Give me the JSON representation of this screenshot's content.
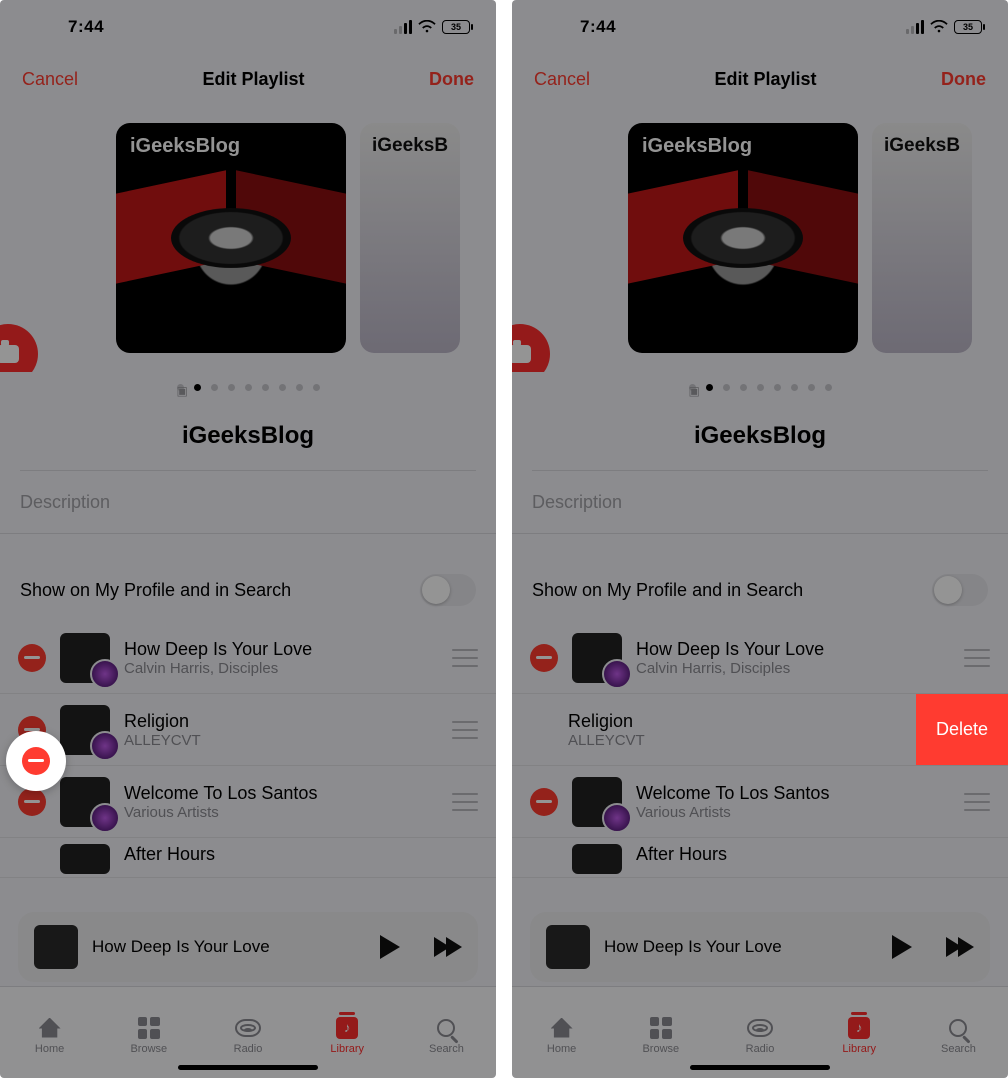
{
  "status": {
    "time": "7:44",
    "battery": "35"
  },
  "nav": {
    "cancel": "Cancel",
    "title": "Edit Playlist",
    "done": "Done"
  },
  "cover": {
    "main_title": "iGeeksBlog",
    "right_title": "iGeeksB"
  },
  "playlist_name": "iGeeksBlog",
  "description_placeholder": "Description",
  "toggle_label": "Show on My Profile and in Search",
  "songs": [
    {
      "title": "How Deep Is Your Love",
      "artist": "Calvin Harris, Disciples"
    },
    {
      "title": "Religion",
      "artist": "ALLEYCVT"
    },
    {
      "title": "Welcome To Los Santos",
      "artist": "Various Artists"
    },
    {
      "title": "After Hours",
      "artist": ""
    }
  ],
  "delete_label": "Delete",
  "now_playing": {
    "title": "How Deep Is Your Love"
  },
  "tabs": {
    "home": "Home",
    "browse": "Browse",
    "radio": "Radio",
    "library": "Library",
    "search": "Search"
  }
}
